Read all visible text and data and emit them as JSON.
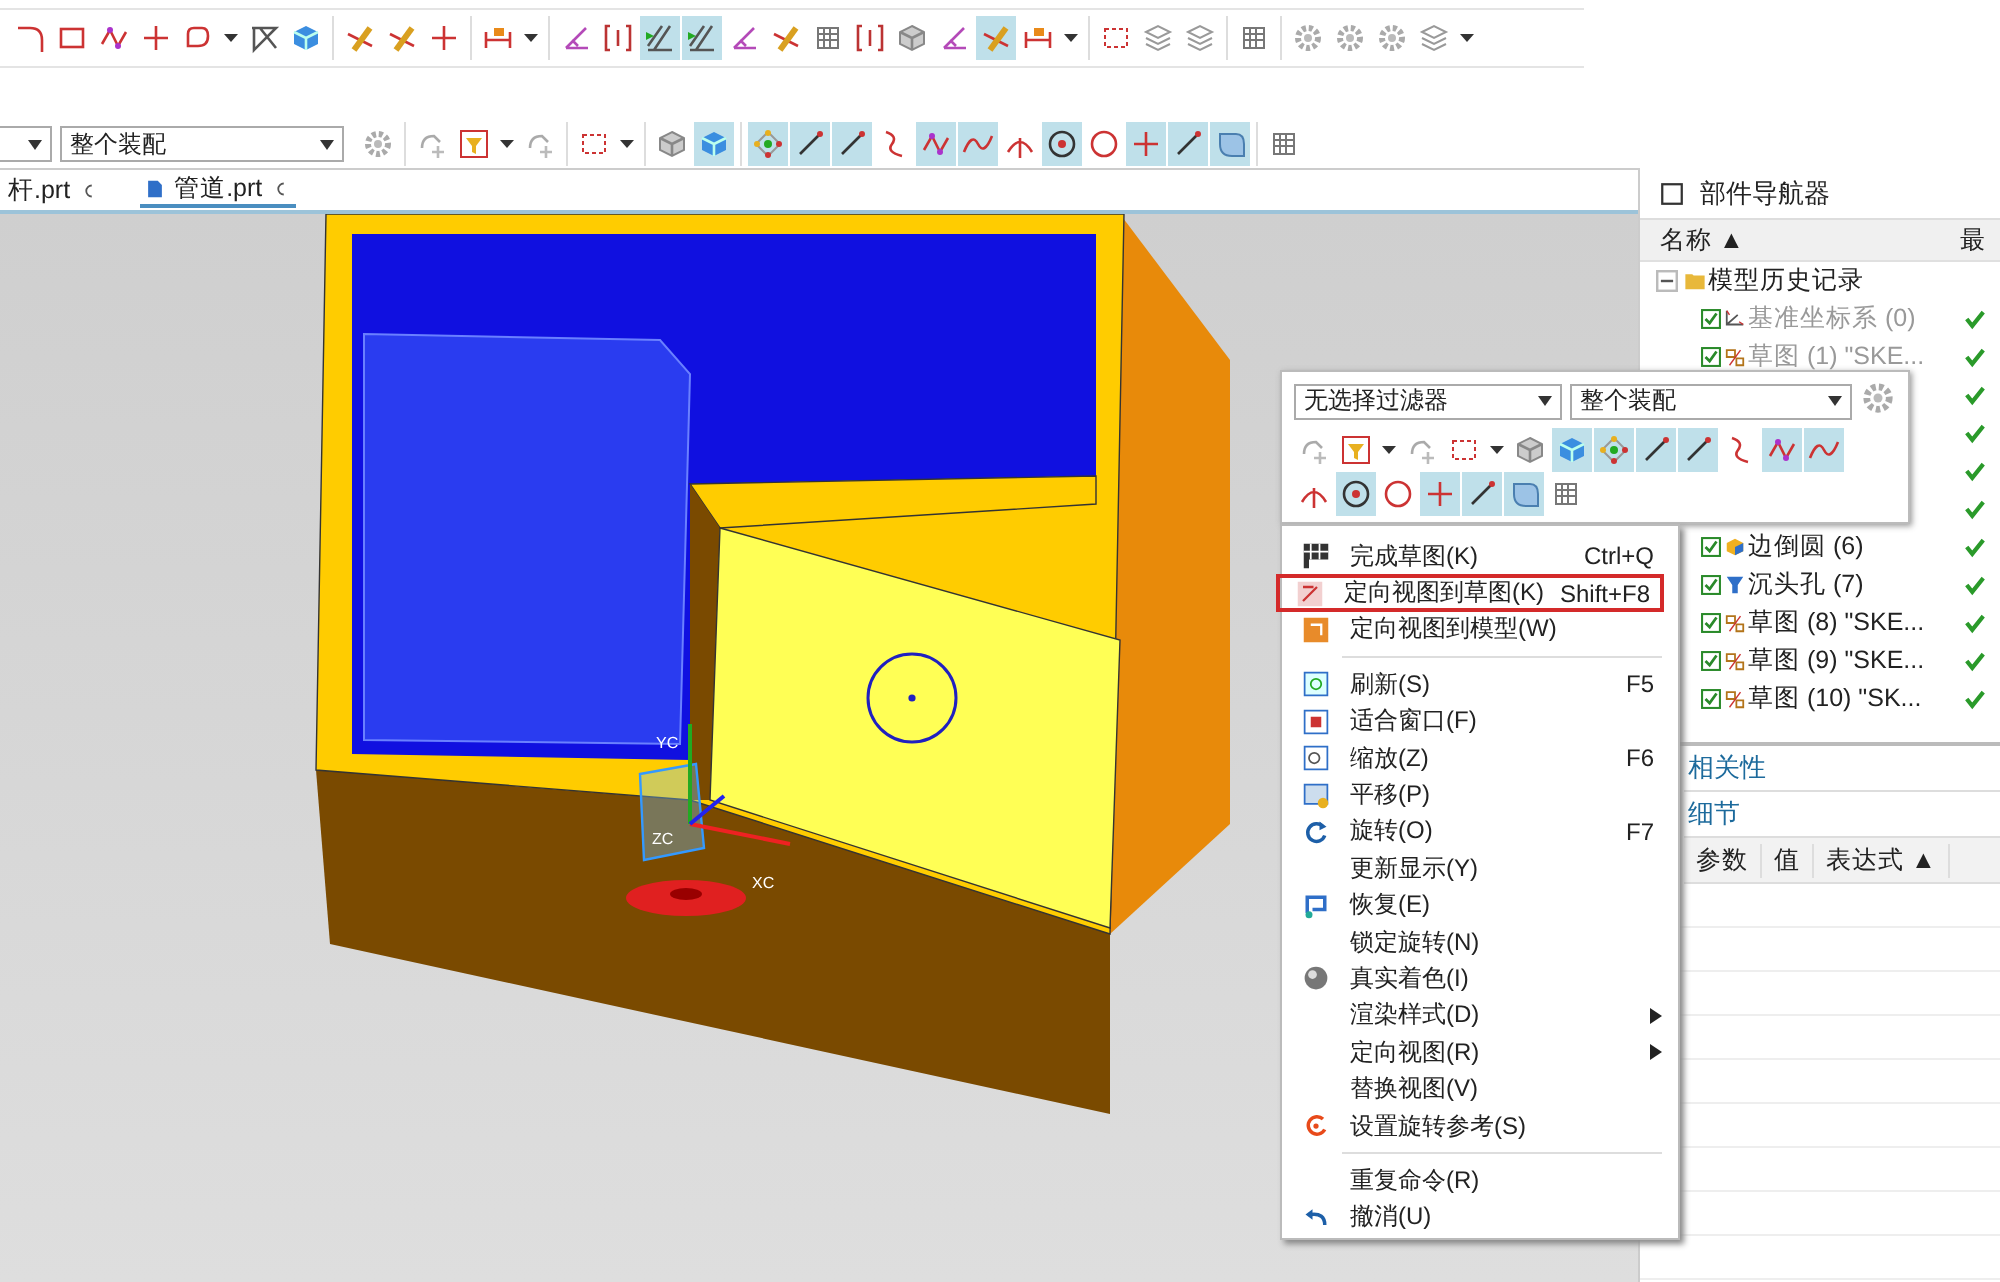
{
  "toolbar_top": [
    [
      {
        "kind": "fillet",
        "selected": false
      },
      {
        "kind": "rect",
        "selected": false
      },
      {
        "kind": "polyline",
        "selected": false
      },
      {
        "kind": "plus",
        "selected": false
      },
      {
        "kind": "profile",
        "selected": false
      },
      {
        "kind": "caret",
        "selected": false
      },
      {
        "kind": "trim",
        "selected": false
      },
      {
        "kind": "cube",
        "selected": false
      }
    ],
    [
      {
        "kind": "pen",
        "selected": false
      },
      {
        "kind": "pen",
        "selected": false
      },
      {
        "kind": "plus",
        "selected": false
      }
    ],
    [
      {
        "kind": "dimension",
        "selected": false
      },
      {
        "kind": "caret",
        "selected": false
      }
    ],
    [
      {
        "kind": "angle",
        "selected": false
      },
      {
        "kind": "bracket",
        "selected": false
      },
      {
        "kind": "constraint",
        "selected": true
      },
      {
        "kind": "constraint",
        "selected": true
      },
      {
        "kind": "angle",
        "selected": false
      },
      {
        "kind": "pen",
        "selected": false
      },
      {
        "kind": "grid",
        "selected": false
      },
      {
        "kind": "bracket",
        "selected": false
      },
      {
        "kind": "cube-grey",
        "selected": false
      },
      {
        "kind": "angle",
        "selected": false
      },
      {
        "kind": "pen",
        "selected": true
      },
      {
        "kind": "dimension",
        "selected": false
      },
      {
        "kind": "caret",
        "selected": false
      }
    ],
    [
      {
        "kind": "select-box",
        "selected": false
      },
      {
        "kind": "stack",
        "selected": false
      },
      {
        "kind": "stack",
        "selected": false
      }
    ],
    [
      {
        "kind": "grid",
        "selected": false
      }
    ],
    [
      {
        "kind": "gear",
        "selected": false
      },
      {
        "kind": "gear",
        "selected": false
      },
      {
        "kind": "gear",
        "selected": false
      },
      {
        "kind": "stack",
        "selected": false
      },
      {
        "kind": "caret",
        "selected": false
      }
    ]
  ],
  "toolbar_selection": {
    "dropdowns": [
      {
        "kind": "narrow"
      },
      {
        "kind": "wide",
        "value": "整个装配"
      }
    ],
    "groups": [
      [
        {
          "kind": "gear",
          "selected": false
        }
      ],
      [
        {
          "kind": "point-snap",
          "selected": false
        },
        {
          "kind": "filter",
          "selected": false
        },
        {
          "kind": "caret",
          "selected": false
        },
        {
          "kind": "point-snap",
          "selected": false
        }
      ],
      [
        {
          "kind": "select-box",
          "selected": false
        },
        {
          "kind": "caret",
          "selected": false
        }
      ],
      [
        {
          "kind": "cube-grey",
          "selected": false
        },
        {
          "kind": "cube",
          "selected": true
        }
      ],
      [
        {
          "kind": "points",
          "selected": true
        },
        {
          "kind": "line",
          "selected": true
        },
        {
          "kind": "line",
          "selected": true
        },
        {
          "kind": "curve",
          "selected": false
        },
        {
          "kind": "polyline",
          "selected": true
        },
        {
          "kind": "spline",
          "selected": true
        },
        {
          "kind": "arc-point",
          "selected": false
        },
        {
          "kind": "circle-dot",
          "selected": true
        },
        {
          "kind": "circle",
          "selected": false
        },
        {
          "kind": "plus",
          "selected": true
        },
        {
          "kind": "line",
          "selected": true
        },
        {
          "kind": "face",
          "selected": true
        }
      ],
      [
        {
          "kind": "grid",
          "selected": false
        }
      ]
    ]
  },
  "file_tabs": [
    {
      "label": "杆.prt",
      "kind": "plain",
      "selected": false
    },
    {
      "label": "管道.prt",
      "kind": "part",
      "selected": true
    }
  ],
  "viewport": {
    "axis_labels": [
      "YC",
      "ZC",
      "XC"
    ]
  },
  "part_navigator": {
    "title": "部件导航器",
    "columns": [
      {
        "label": "名称 ▲"
      },
      {
        "label": "最"
      }
    ],
    "tree": [
      {
        "name": "模型历史记录",
        "expanded": true,
        "children": [
          {
            "name": "基准坐标系 (0)",
            "kind": "csys",
            "checked": true,
            "dimmed": true,
            "up_to_date": true
          },
          {
            "name": "草图 (1) \"SKE...",
            "kind": "sketch",
            "checked": true,
            "dimmed": true,
            "up_to_date": true
          },
          {
            "up_to_date": true
          },
          {
            "up_to_date": true
          },
          {
            "up_to_date": true
          },
          {
            "up_to_date": true
          },
          {
            "name": "边倒圆 (6)",
            "kind": "blend",
            "checked": true,
            "dimmed": false,
            "up_to_date": true
          },
          {
            "name": "沉头孔 (7)",
            "kind": "hole",
            "checked": true,
            "dimmed": false,
            "up_to_date": true
          },
          {
            "name": "草图 (8) \"SKE...",
            "kind": "sketch",
            "checked": true,
            "dimmed": false,
            "up_to_date": true
          },
          {
            "name": "草图 (9) \"SKE...",
            "kind": "sketch",
            "checked": true,
            "dimmed": false,
            "up_to_date": true
          },
          {
            "name": "草图 (10) \"SK...",
            "kind": "sketch",
            "checked": true,
            "dimmed": false,
            "up_to_date": true
          }
        ]
      }
    ],
    "sections": [
      "相关性",
      "细节"
    ],
    "details_columns": [
      {
        "label": "参数"
      },
      {
        "label": "值"
      },
      {
        "label": "表达式 ▲"
      }
    ]
  },
  "selection_popup": {
    "filter": "无选择过滤器",
    "scope": "整个装配",
    "row_1": [
      {
        "kind": "point-snap",
        "selected": false
      },
      {
        "kind": "filter",
        "selected": false
      },
      {
        "kind": "caret",
        "selected": false
      },
      {
        "kind": "point-snap",
        "selected": false
      },
      {
        "kind": "select-box",
        "selected": false
      },
      {
        "kind": "caret",
        "selected": false
      },
      {
        "kind": "cube-grey",
        "selected": false
      },
      {
        "kind": "cube",
        "selected": true
      },
      {
        "kind": "points",
        "selected": true
      },
      {
        "kind": "line",
        "selected": true
      },
      {
        "kind": "line",
        "selected": true
      },
      {
        "kind": "curve",
        "selected": false
      },
      {
        "kind": "polyline",
        "selected": true
      },
      {
        "kind": "spline",
        "selected": true
      }
    ],
    "row_2": [
      {
        "kind": "arc-point",
        "selected": false
      },
      {
        "kind": "circle-dot",
        "selected": true
      },
      {
        "kind": "circle",
        "selected": false
      },
      {
        "kind": "plus",
        "selected": true
      },
      {
        "kind": "line",
        "selected": true
      },
      {
        "kind": "face",
        "selected": true
      },
      {
        "kind": "grid",
        "selected": false
      }
    ]
  },
  "context_menu": [
    {
      "kind": "flag",
      "label": "完成草图(K)",
      "shortcut": "Ctrl+Q",
      "submenu": false,
      "highlighted": false
    },
    {
      "kind": "orient-sketch",
      "label": "定向视图到草图(K)",
      "shortcut": "Shift+F8",
      "submenu": false,
      "highlighted": true
    },
    {
      "kind": "orient-model",
      "label": "定向视图到模型(W)",
      "submenu": false,
      "highlighted": false
    },
    {
      "kind": "separator"
    },
    {
      "kind": "refresh",
      "label": "刷新(S)",
      "shortcut": "F5",
      "submenu": false,
      "highlighted": false
    },
    {
      "kind": "fit",
      "label": "适合窗口(F)",
      "submenu": false,
      "highlighted": false
    },
    {
      "kind": "zoom",
      "label": "缩放(Z)",
      "shortcut": "F6",
      "submenu": false,
      "highlighted": false
    },
    {
      "kind": "pan",
      "label": "平移(P)",
      "submenu": false,
      "highlighted": false
    },
    {
      "kind": "rotate",
      "label": "旋转(O)",
      "shortcut": "F7",
      "submenu": false,
      "highlighted": false
    },
    {
      "kind": "plain",
      "label": "更新显示(Y)",
      "submenu": false,
      "highlighted": false
    },
    {
      "kind": "restore",
      "label": "恢复(E)",
      "submenu": false,
      "highlighted": false
    },
    {
      "kind": "plain",
      "label": "锁定旋转(N)",
      "submenu": false,
      "highlighted": false
    },
    {
      "kind": "sphere",
      "label": "真实着色(I)",
      "submenu": false,
      "highlighted": false
    },
    {
      "kind": "plain",
      "label": "渲染样式(D)",
      "submenu": true,
      "highlighted": false
    },
    {
      "kind": "plain",
      "label": "定向视图(R)",
      "submenu": true,
      "highlighted": false
    },
    {
      "kind": "plain",
      "label": "替换视图(V)",
      "submenu": false,
      "highlighted": false
    },
    {
      "kind": "rotate-ref",
      "label": "设置旋转参考(S)",
      "submenu": false,
      "highlighted": false
    },
    {
      "kind": "separator"
    },
    {
      "kind": "plain",
      "label": "重复命令(R)",
      "submenu": false,
      "highlighted": false
    },
    {
      "kind": "undo",
      "label": "撤消(U)",
      "submenu": false,
      "highlighted": false
    }
  ]
}
